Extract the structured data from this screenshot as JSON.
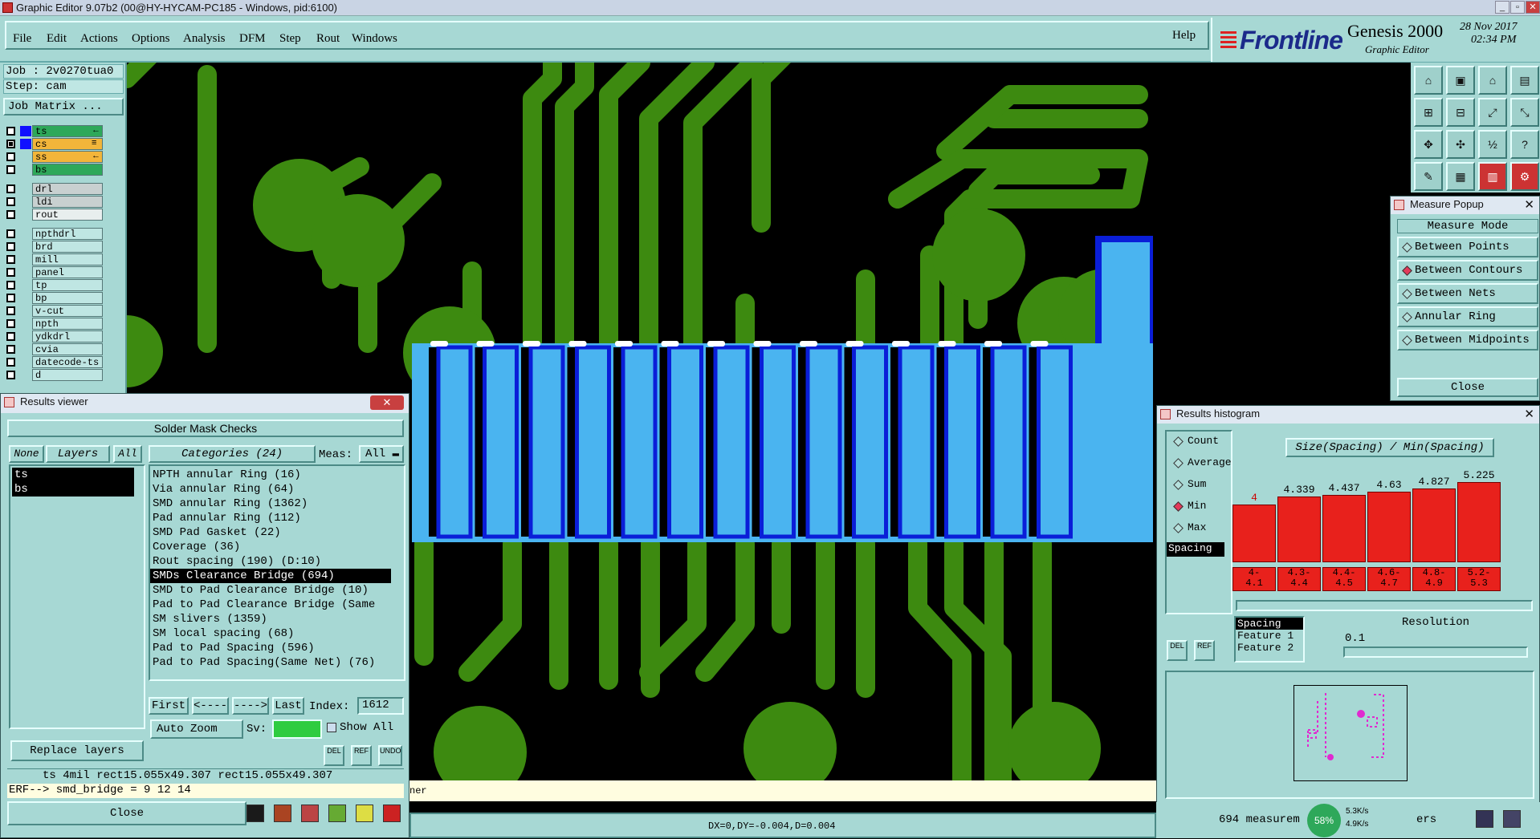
{
  "window": {
    "title": "Graphic Editor 9.07b2 (00@HY-HYCAM-PC185 - Windows, pid:6100)"
  },
  "menu": {
    "items": [
      "File",
      "Edit",
      "Actions",
      "Options",
      "Analysis",
      "DFM",
      "Step",
      "Rout",
      "Windows"
    ],
    "help": "Help"
  },
  "brand": {
    "logo": "Frontline",
    "product": "Genesis 2000",
    "sub": "Graphic Editor",
    "date": "28 Nov 2017",
    "time": "02:34 PM"
  },
  "job": {
    "job": "Job : 2v0270tua0",
    "step": "Step: cam",
    "matrix_btn": "Job Matrix ..."
  },
  "layers": [
    {
      "name": "ts",
      "mark": "←",
      "color": "#2ea85a",
      "swatch": "#1010ff",
      "checked": false
    },
    {
      "name": "cs",
      "mark": "≡",
      "color": "#f2b53a",
      "swatch": "#1010ff",
      "checked": true
    },
    {
      "name": "ss",
      "mark": "←",
      "color": "#f2b53a",
      "swatch": "#a7d8d4",
      "checked": false
    },
    {
      "name": "bs",
      "mark": "",
      "color": "#2ea85a",
      "swatch": "#a7d8d4",
      "checked": false
    },
    {
      "name": "drl",
      "mark": "",
      "color": "#c8d0d0",
      "swatch": "#a7d8d4",
      "checked": false
    },
    {
      "name": "ldi",
      "mark": "",
      "color": "#c8d0d0",
      "swatch": "#a7d8d4",
      "checked": false
    },
    {
      "name": "rout",
      "mark": "",
      "color": "#e8eeee",
      "swatch": "#a7d8d4",
      "checked": false
    },
    {
      "name": "npthdrl",
      "mark": "",
      "color": "#bfe6e3",
      "swatch": "#a7d8d4",
      "checked": false
    },
    {
      "name": "brd",
      "mark": "",
      "color": "#bfe6e3",
      "swatch": "#a7d8d4",
      "checked": false
    },
    {
      "name": "mill",
      "mark": "",
      "color": "#bfe6e3",
      "swatch": "#a7d8d4",
      "checked": false
    },
    {
      "name": "panel",
      "mark": "",
      "color": "#bfe6e3",
      "swatch": "#a7d8d4",
      "checked": false
    },
    {
      "name": "tp",
      "mark": "",
      "color": "#bfe6e3",
      "swatch": "#a7d8d4",
      "checked": false
    },
    {
      "name": "bp",
      "mark": "",
      "color": "#bfe6e3",
      "swatch": "#a7d8d4",
      "checked": false
    },
    {
      "name": "v-cut",
      "mark": "",
      "color": "#bfe6e3",
      "swatch": "#a7d8d4",
      "checked": false
    },
    {
      "name": "npth",
      "mark": "",
      "color": "#bfe6e3",
      "swatch": "#a7d8d4",
      "checked": false
    },
    {
      "name": "ydkdrl",
      "mark": "",
      "color": "#bfe6e3",
      "swatch": "#a7d8d4",
      "checked": false
    },
    {
      "name": "cvia",
      "mark": "",
      "color": "#bfe6e3",
      "swatch": "#a7d8d4",
      "checked": false
    },
    {
      "name": "datecode-ts",
      "mark": "",
      "color": "#bfe6e3",
      "swatch": "#a7d8d4",
      "checked": false
    },
    {
      "name": "d",
      "mark": "",
      "color": "#bfe6e3",
      "swatch": "#a7d8d4",
      "checked": false
    }
  ],
  "measure": {
    "title": "Measure Popup",
    "mode_label": "Measure Mode",
    "modes": [
      "Between Points",
      "Between Contours",
      "Between Nets",
      "Annular Ring",
      "Between Midpoints"
    ],
    "selected": 1,
    "close": "Close"
  },
  "results_viewer": {
    "title": "Results viewer",
    "header": "Solder Mask Checks",
    "none_btn": "None",
    "layers_btn": "Layers",
    "all_btn": "All",
    "layer_list": [
      "ts",
      "bs"
    ],
    "categories_btn": "Categories (24)",
    "meas_label": "Meas:",
    "meas_value": "All",
    "categories": [
      "NPTH annular Ring (16)",
      "Via annular Ring (64)",
      "SMD annular Ring (1362)",
      "Pad annular Ring (112)",
      "SMD Pad Gasket (22)",
      "Coverage (36)",
      "Rout spacing (190)          (D:10)",
      "SMDs Clearance Bridge (694)",
      "SMD to Pad Clearance Bridge (10)",
      "Pad to Pad Clearance Bridge (Same",
      "SM slivers (1359)",
      "SM local spacing (68)",
      "Pad to Pad Spacing (596)",
      "Pad to Pad Spacing(Same Net) (76)"
    ],
    "selected_category": 7,
    "nav": {
      "first": "First",
      "prev": "<----",
      "next": "---->",
      "last": "Last",
      "index_label": "Index:",
      "index": "1612"
    },
    "auto_zoom": "Auto Zoom",
    "sv_label": "Sv:",
    "show_all": "Show All",
    "replace_layers": "Replace layers",
    "del": "DEL",
    "ref": "REF",
    "undo": "UNDO",
    "result_line": "ts   4mil   rect15.055x49.307   rect15.055x49.307",
    "erf_line": "ERF--> smd_bridge = 9 12 14",
    "close": "Close"
  },
  "histogram": {
    "title": "Results histogram",
    "stats": [
      "Count",
      "Average",
      "Sum",
      "Min",
      "Max"
    ],
    "stat_selected": 3,
    "spacing_item": "Spacing",
    "chart_title": "Size(Spacing) / Min(Spacing)",
    "bars": [
      {
        "value": "4",
        "label": "4-\n4.1",
        "level": 0.72,
        "value_color": "#c00"
      },
      {
        "value": "4.339",
        "label": "4.3-\n4.4",
        "level": 0.82,
        "value_color": "#000"
      },
      {
        "value": "4.437",
        "label": "4.4-\n4.5",
        "level": 0.84,
        "value_color": "#000"
      },
      {
        "value": "4.63",
        "label": "4.6-\n4.7",
        "level": 0.88,
        "value_color": "#000"
      },
      {
        "value": "4.827",
        "label": "4.8-\n4.9",
        "level": 0.92,
        "value_color": "#000"
      },
      {
        "value": "5.225",
        "label": "5.2-\n5.3",
        "level": 1.0,
        "value_color": "#000"
      }
    ],
    "feature_list": [
      "Spacing",
      "Feature 1",
      "Feature 2"
    ],
    "resolution_label": "Resolution",
    "resolution_value": "0.1",
    "count_text": "694 measurem",
    "del": "DEL",
    "ref": "REF"
  },
  "status": {
    "left_tail": "ner",
    "coords": "DX=0,DY=-0.004,D=0.004",
    "ers": "ers",
    "net_up": "5.3K/s",
    "net_down": "4.9K/s",
    "cpu": "58%"
  },
  "colors": {
    "panel": "#a7d8d4",
    "copper": "#3d8a10",
    "pad": "#4ab4f0",
    "pad_outline": "#0a1ed8",
    "hist_bar": "#e8211c"
  }
}
